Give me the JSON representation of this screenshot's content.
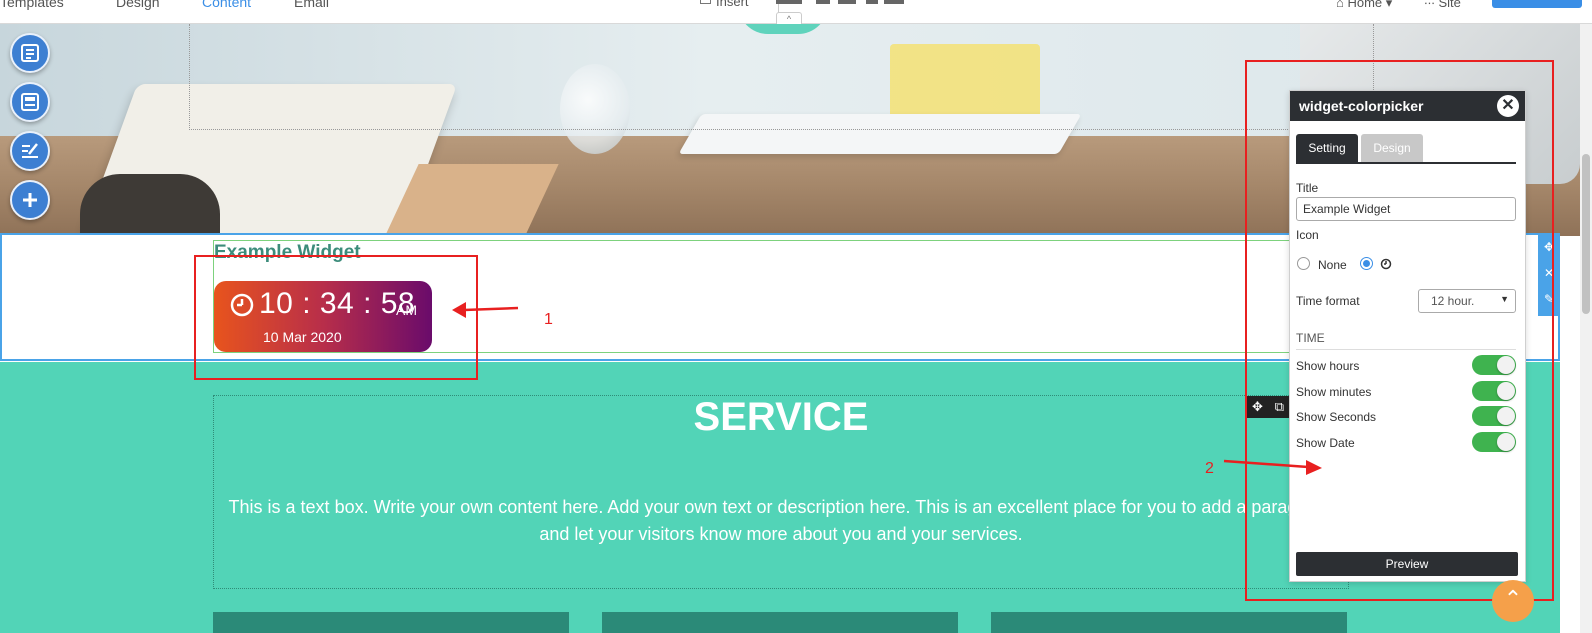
{
  "topbar": {
    "tabs": [
      "Templates",
      "Design",
      "Content",
      "Email"
    ],
    "active_tab": "Content",
    "insert_label": "Insert",
    "page_select": "Home",
    "site_label": "Site"
  },
  "widget": {
    "title": "Example Widget",
    "time": "10 : 34 : 58",
    "ampm": "AM",
    "date": "10 Mar 2020"
  },
  "service": {
    "title": "SERVICE",
    "text": "This is a text box. Write your own content here. Add your own text or description here. This is an excellent place for you to add a paragraph and let your visitors know more about you and your services."
  },
  "panel": {
    "title": "widget-colorpicker",
    "tabs": {
      "setting": "Setting",
      "design": "Design"
    },
    "title_label": "Title",
    "title_value": "Example Widget",
    "icon_label": "Icon",
    "icon_none": "None",
    "time_format_label": "Time format",
    "time_format_value": "12 hour.",
    "section_time": "TIME",
    "toggles": [
      {
        "label": "Show hours",
        "on": true
      },
      {
        "label": "Show minutes",
        "on": true
      },
      {
        "label": "Show Seconds",
        "on": true
      },
      {
        "label": "Show Date",
        "on": true
      }
    ],
    "preview_label": "Preview"
  },
  "annotations": {
    "one": "1",
    "two": "2"
  },
  "colors": {
    "accent_blue": "#3a8ee6",
    "teal": "#52d4b7",
    "panel_dark": "#2c2f33",
    "toggle_green": "#3fb34f",
    "annotation_red": "#e82020",
    "clock_gradient_start": "#e8541d",
    "clock_gradient_end": "#6a0b6b"
  }
}
